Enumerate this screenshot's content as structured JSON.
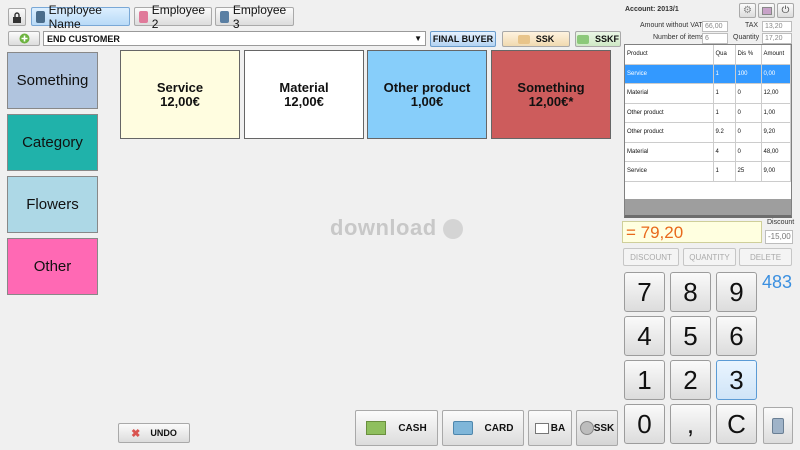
{
  "employees": [
    {
      "label": "Employee Name",
      "active": true
    },
    {
      "label": "Employee 2",
      "active": false
    },
    {
      "label": "Employee 3",
      "active": false
    }
  ],
  "customer": {
    "selected": "END CUSTOMER",
    "final_buyer_label": "FINAL BUYER",
    "ssk_label": "SSK",
    "sskf_label": "SSKF"
  },
  "categories": [
    {
      "label": "Something",
      "color": "#b0c4de"
    },
    {
      "label": "Category",
      "color": "#20b2aa"
    },
    {
      "label": "Flowers",
      "color": "#add8e6"
    },
    {
      "label": "Other",
      "color": "#ff69b4"
    }
  ],
  "products": [
    {
      "name": "Service",
      "price": "12,00€",
      "color": "#fffde0"
    },
    {
      "name": "Material",
      "price": "12,00€",
      "color": "#ffffff"
    },
    {
      "name": "Other product",
      "price": "1,00€",
      "color": "#87cefa"
    },
    {
      "name": "Something",
      "price": "12,00€*",
      "color": "#cd5c5c"
    }
  ],
  "watermark": "download",
  "bottom": {
    "undo_label": "UNDO",
    "cash_label": "CASH",
    "card_label": "CARD",
    "ba_label": "BA",
    "ssk_label": "SSK"
  },
  "account": {
    "label": "Account:",
    "value": "2013/1",
    "amount_without_vat_label": "Amount without VAT",
    "amount_without_vat": "66,00",
    "tax_label": "TAX",
    "tax": "13,20",
    "number_of_items_label": "Number of items",
    "number_of_items": "6",
    "quantity_label": "Quantity",
    "quantity": "17,20"
  },
  "table": {
    "headers": [
      "Product",
      "Qua",
      "Dis %",
      "Amount"
    ],
    "rows": [
      [
        "Service",
        "1",
        "100",
        "0,00"
      ],
      [
        "Material",
        "1",
        "0",
        "12,00"
      ],
      [
        "Other product",
        "1",
        "0",
        "1,00"
      ],
      [
        "Other product",
        "9.2",
        "0",
        "9,20"
      ],
      [
        "Material",
        "4",
        "0",
        "48,00"
      ],
      [
        "Service",
        "1",
        "25",
        "9,00"
      ]
    ],
    "selected_row": 0
  },
  "total": "= 79,20",
  "discount": {
    "label": "Discount",
    "value": "-15,00"
  },
  "actions": {
    "discount": "DISCOUNT",
    "quantity": "QUANTITY",
    "delete": "DELETE"
  },
  "keypad": [
    "7",
    "8",
    "9",
    "4",
    "5",
    "6",
    "1",
    "2",
    "3",
    "0",
    ",",
    "C"
  ],
  "counter": "483"
}
